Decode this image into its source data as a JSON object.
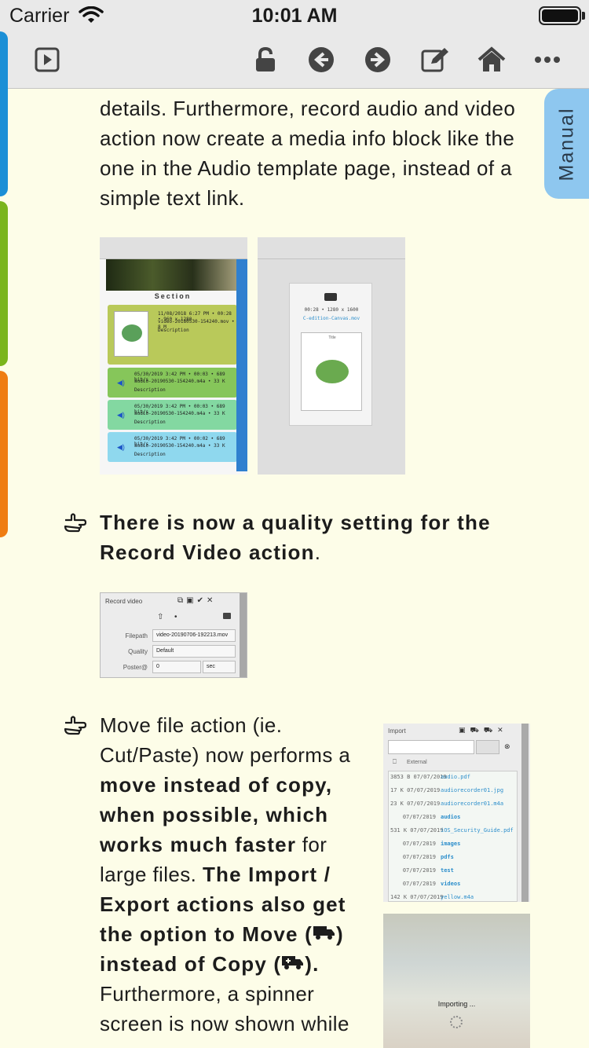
{
  "status_bar": {
    "carrier": "Carrier",
    "time": "10:01 AM"
  },
  "toolbar": {
    "icons": [
      "play-square-icon",
      "unlock-icon",
      "back-arrow-icon",
      "forward-arrow-icon",
      "edit-icon",
      "home-icon",
      "more-icon"
    ]
  },
  "side_tabs": {
    "colors": [
      "#1b8fd6",
      "#7ab51d",
      "#ef7d12"
    ],
    "manual_label": "Manual",
    "manual_color": "#8ec7ef"
  },
  "content": {
    "para1": "details. Furthermore, record audio and video action now create a media info block like the one in the Audio template page, instead of a simple text link.",
    "bullet1": "There is now a quality setting for the Record Video action",
    "bullet1_end": ".",
    "bullet2": {
      "t1": "Move file action (ie. Cut/Paste) now performs a",
      "b1": "move instead of copy, when possible, which works much faster",
      "t2": "for large files.",
      "b2": "The Import / Export actions also get the option to Move (",
      "b3": ") instead of Copy (",
      "b4": ").",
      "t3": "Furthermore, a spinner screen is now shown while"
    }
  },
  "thumb_a": {
    "section": "Section",
    "cards": [
      {
        "l1": "11/08/2018  6:27 PM  •  00:28  •  960 x 1280",
        "l2": "video-20180530-154240.mov  •  8 M",
        "l3": "Description",
        "color": "#b9c95a"
      },
      {
        "l1": "05/30/2019  3:42 PM  •  00:03  •  689 bit/s",
        "l2": "audio-20190530-154240.m4a  •  33 K",
        "l3": "Description",
        "color": "#86c65a"
      },
      {
        "l1": "05/30/2019  3:42 PM  •  00:03  •  689 bit/s",
        "l2": "audio-20190530-154240.m4a  •  33 K",
        "l3": "Description",
        "color": "#83d8a1"
      },
      {
        "l1": "05/30/2019  3:42 PM  •  00:02  •  689 bit/s",
        "l2": "audio-20190530-154240.m4a  •  33 K",
        "l3": "Description",
        "color": "#8fd8ee"
      }
    ]
  },
  "thumb_b": {
    "meta": "00:28  •  1280 x 1600",
    "file": "C-edition-Canvas.mov",
    "inner_title": "Title"
  },
  "record_video": {
    "title": "Record video",
    "filepath_label": "Filepath",
    "filepath_value": "video-20190706-192213.mov",
    "quality_label": "Quality",
    "quality_value": "Default",
    "poster_label": "Poster@",
    "poster_value": "0",
    "poster_unit": "sec"
  },
  "import": {
    "title": "Import",
    "external_label": "External",
    "rows": [
      {
        "n": "3853  B  07/07/2019",
        "f": "audio.pdf",
        "dir": false
      },
      {
        "n": "17  K  07/07/2019",
        "f": "audiorecorder01.jpg",
        "dir": false
      },
      {
        "n": "23  K  07/07/2019",
        "f": "audiorecorder01.m4a",
        "dir": false
      },
      {
        "n": "07/07/2019",
        "f": "audios",
        "dir": true
      },
      {
        "n": "531  K  07/07/2019",
        "f": "iOS_Security_Guide.pdf",
        "dir": false
      },
      {
        "n": "07/07/2019",
        "f": "images",
        "dir": true
      },
      {
        "n": "07/07/2019",
        "f": "pdfs",
        "dir": true
      },
      {
        "n": "07/07/2019",
        "f": "test",
        "dir": true
      },
      {
        "n": "07/07/2019",
        "f": "videos",
        "dir": true
      },
      {
        "n": "142  K  07/07/2019",
        "f": "yellow.m4a",
        "dir": false
      }
    ]
  },
  "importing": {
    "text": "Importing ..."
  }
}
